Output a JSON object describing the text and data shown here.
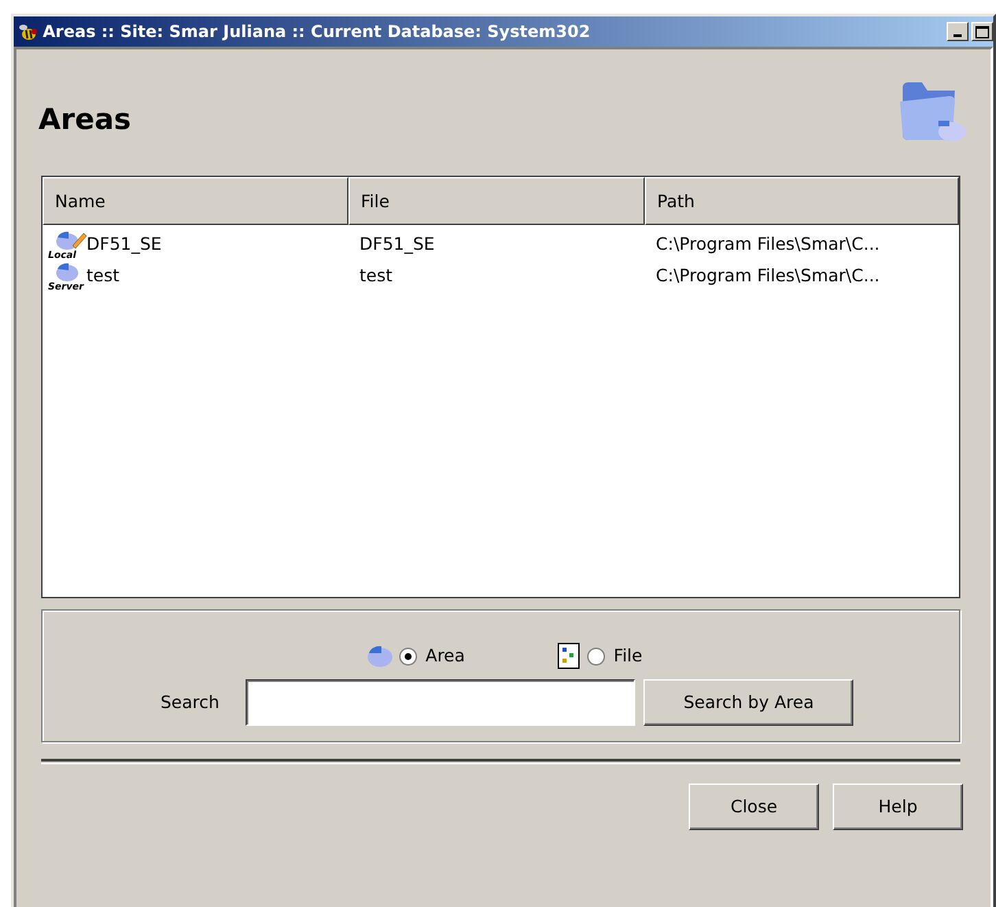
{
  "window": {
    "title": "Areas  ::  Site: Smar Juliana  ::  Current Database: System302"
  },
  "heading": "Areas",
  "table": {
    "columns": [
      "Name",
      "File",
      "Path"
    ],
    "rows": [
      {
        "kind": "local",
        "badge": "Local",
        "name": "DF51_SE",
        "file": "DF51_SE",
        "path": "C:\\Program Files\\Smar\\C..."
      },
      {
        "kind": "server",
        "badge": "Server",
        "name": "test",
        "file": "test",
        "path": "C:\\Program Files\\Smar\\C..."
      }
    ]
  },
  "search_by": [
    {
      "kind": "area",
      "label": "Area",
      "selected": true
    },
    {
      "kind": "file",
      "label": "File",
      "selected": false
    }
  ],
  "search": {
    "label": "Search",
    "button": "Search by Area"
  },
  "buttons": [
    "Close",
    "Help"
  ]
}
